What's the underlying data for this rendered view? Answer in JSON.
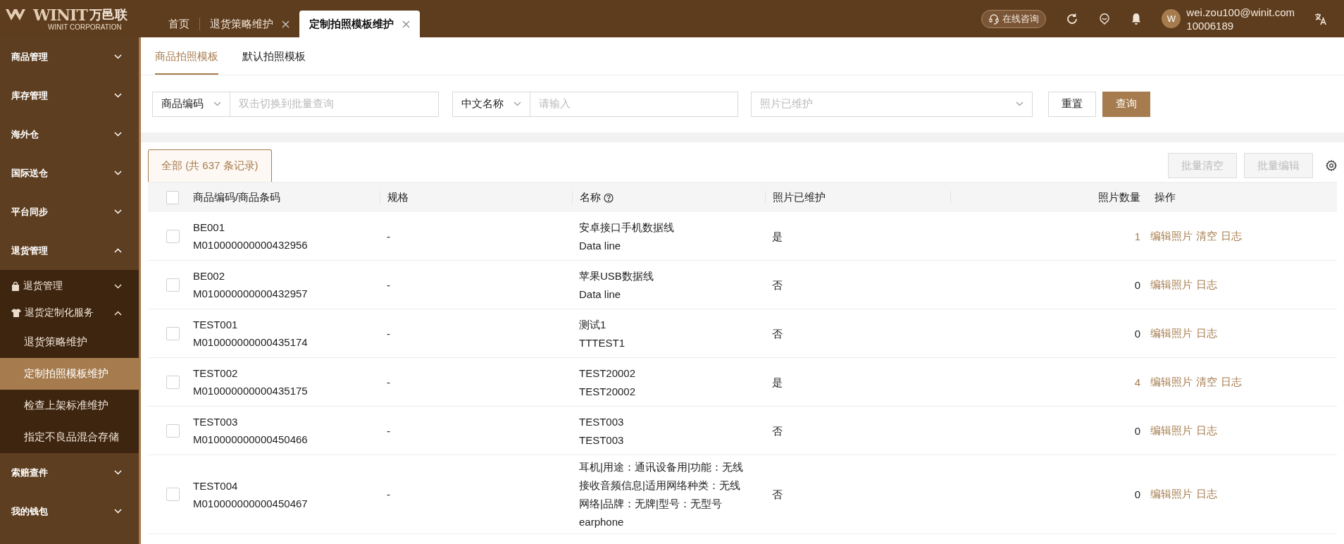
{
  "logo": {
    "mark": "WINIT",
    "name": "万邑联",
    "subtitle": "WINIT CORPORATION"
  },
  "top_tabs": [
    {
      "label": "首页",
      "selected": false,
      "closable": false
    },
    {
      "label": "退货策略维护",
      "selected": false,
      "closable": true
    },
    {
      "label": "定制拍照模板维护",
      "selected": true,
      "closable": true
    }
  ],
  "header": {
    "consult": "在线咨询",
    "avatar": "W",
    "email": "wei.zou100@winit.com",
    "account": "10006189"
  },
  "sidebar": {
    "items": [
      {
        "label": "商品管理",
        "expanded": false
      },
      {
        "label": "库存管理",
        "expanded": false
      },
      {
        "label": "海外仓",
        "expanded": false
      },
      {
        "label": "国际送仓",
        "expanded": false
      },
      {
        "label": "平台同步",
        "expanded": false
      },
      {
        "label": "退货管理",
        "expanded": true,
        "children": [
          {
            "label": "退货管理",
            "expanded": false
          },
          {
            "label": "退货定制化服务",
            "expanded": true,
            "children": [
              {
                "label": "退货策略维护",
                "selected": false
              },
              {
                "label": "定制拍照模板维护",
                "selected": true
              },
              {
                "label": "检查上架标准维护",
                "selected": false
              },
              {
                "label": "指定不良品混合存储",
                "selected": false
              }
            ]
          }
        ]
      },
      {
        "label": "索赔查件",
        "expanded": false
      },
      {
        "label": "我的钱包",
        "expanded": false
      }
    ]
  },
  "page_tabs": [
    {
      "label": "商品拍照模板",
      "selected": true
    },
    {
      "label": "默认拍照模板",
      "selected": false
    }
  ],
  "filters": {
    "code_type": "商品编码",
    "code_placeholder": "双击切换到批量查询",
    "name_type": "中文名称",
    "name_placeholder": "请输入",
    "photo_placeholder": "照片已维护",
    "reset": "重置",
    "search": "查询"
  },
  "table_tab": "全部 (共 637 条记录)",
  "bulk_buttons": [
    {
      "label": "批量清空",
      "disabled": true
    },
    {
      "label": "批量编辑",
      "disabled": true
    }
  ],
  "table": {
    "select_all": false,
    "columns": [
      "商品编码/商品条码",
      "规格",
      "名称",
      "照片已维护",
      "照片数量",
      "操作"
    ],
    "rows": [
      {
        "checked": false,
        "code": "BE001",
        "barcode": "M010000000000432956",
        "spec": "-",
        "name_cn": "安卓接口手机数据线",
        "name_en": "Data line",
        "maintained": "是",
        "count": "1",
        "count_link": true,
        "actions": [
          "编辑照片",
          "清空",
          "日志"
        ]
      },
      {
        "checked": false,
        "code": "BE002",
        "barcode": "M010000000000432957",
        "spec": "-",
        "name_cn": "苹果USB数据线",
        "name_en": "Data line",
        "maintained": "否",
        "count": "0",
        "count_link": false,
        "actions": [
          "编辑照片",
          "日志"
        ]
      },
      {
        "checked": false,
        "code": "TEST001",
        "barcode": "M010000000000435174",
        "spec": "-",
        "name_cn": "测试1",
        "name_en": "TTTEST1",
        "maintained": "否",
        "count": "0",
        "count_link": false,
        "actions": [
          "编辑照片",
          "日志"
        ]
      },
      {
        "checked": false,
        "code": "TEST002",
        "barcode": "M010000000000435175",
        "spec": "-",
        "name_cn": "TEST20002",
        "name_en": "TEST20002",
        "maintained": "是",
        "count": "4",
        "count_link": true,
        "actions": [
          "编辑照片",
          "清空",
          "日志"
        ]
      },
      {
        "checked": false,
        "code": "TEST003",
        "barcode": "M010000000000450466",
        "spec": "-",
        "name_cn": "TEST003",
        "name_en": "TEST003",
        "maintained": "否",
        "count": "0",
        "count_link": false,
        "actions": [
          "编辑照片",
          "日志"
        ]
      },
      {
        "checked": false,
        "code": "TEST004",
        "barcode": "M010000000000450467",
        "spec": "-",
        "name_cn": "耳机|用途：通讯设备用|功能：无线接收音频信息|适用网络种类：无线网络|品牌：无牌|型号：无型号",
        "name_en": "earphone",
        "maintained": "否",
        "count": "0",
        "count_link": false,
        "actions": [
          "编辑照片",
          "日志"
        ]
      }
    ]
  }
}
